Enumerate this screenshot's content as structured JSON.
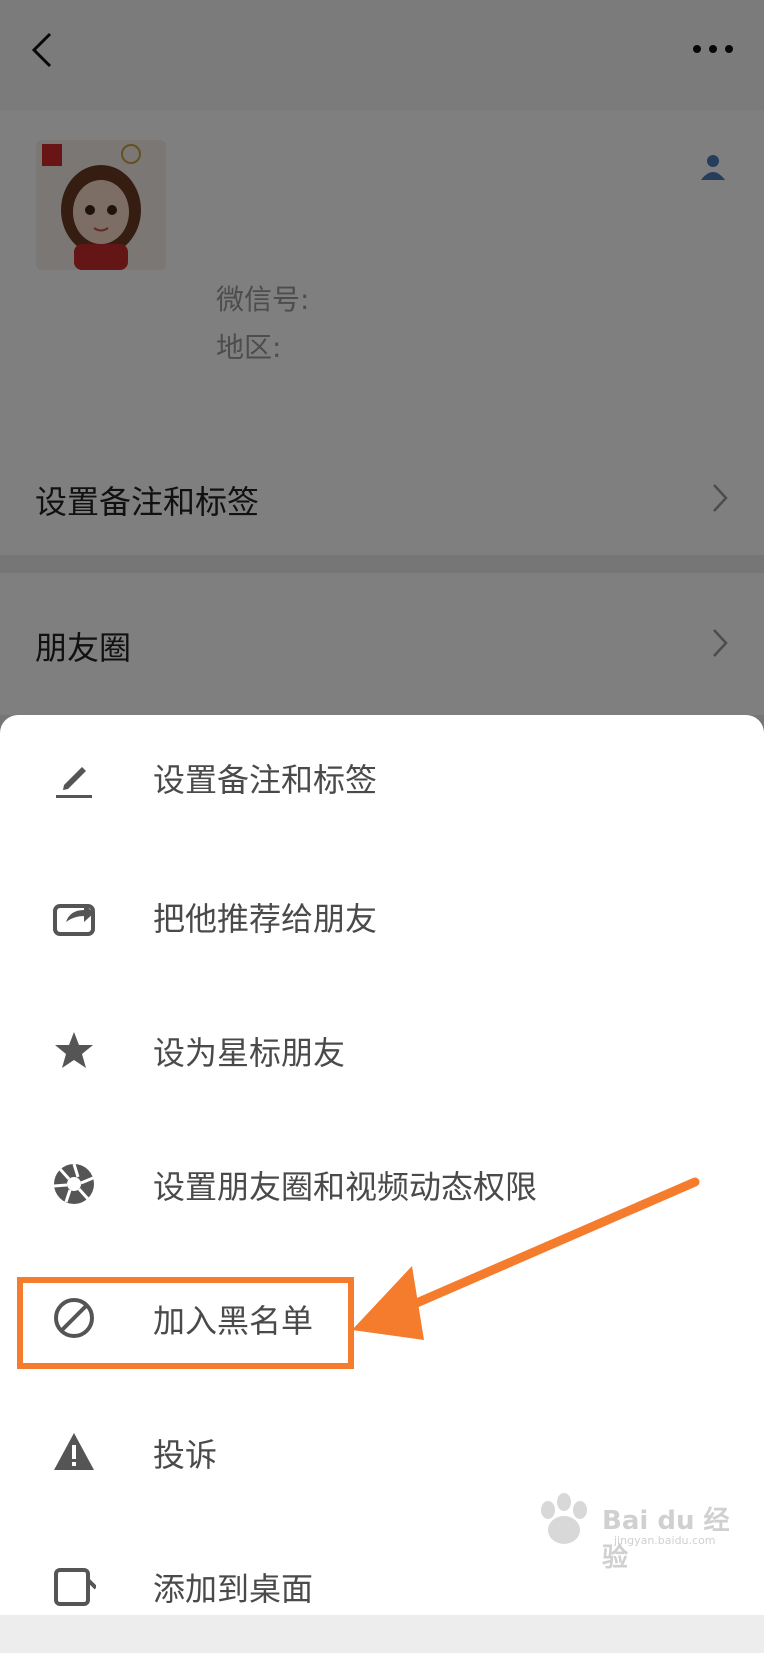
{
  "profile": {
    "wechat_id_label": "微信号:",
    "region_label": "地区:"
  },
  "rows": {
    "remark_tags": "设置备注和标签",
    "moments": "朋友圈"
  },
  "menu": {
    "items": [
      {
        "label": "设置备注和标签",
        "icon": "pencil-icon"
      },
      {
        "label": "把他推荐给朋友",
        "icon": "share-icon"
      },
      {
        "label": "设为星标朋友",
        "icon": "star-icon"
      },
      {
        "label": "设置朋友圈和视频动态权限",
        "icon": "aperture-icon"
      },
      {
        "label": "加入黑名单",
        "icon": "block-icon"
      },
      {
        "label": "投诉",
        "icon": "warning-icon"
      },
      {
        "label": "添加到桌面",
        "icon": "desktop-icon"
      }
    ]
  },
  "annotation": {
    "highlight_color": "#f47c2c"
  },
  "watermark": {
    "text": "Bai du 经验",
    "subtext": "jingyan.baidu.com"
  }
}
